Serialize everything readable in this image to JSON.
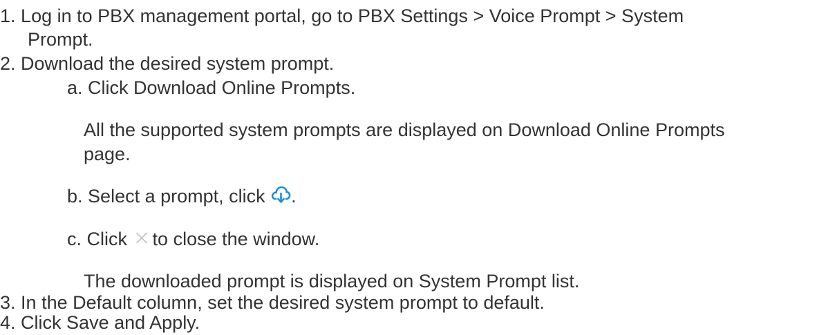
{
  "steps": [
    {
      "number": "1.",
      "text_line1": "Log in to PBX management portal, go to PBX Settings > Voice Prompt > System",
      "text_line2": "Prompt."
    },
    {
      "number": "2.",
      "text": "Download the desired system prompt.",
      "substeps": [
        {
          "letter": "a.",
          "text": "Click Download Online Prompts.",
          "note_line1": "All the supported system prompts are displayed on Download Online Prompts",
          "note_line2": "page."
        },
        {
          "letter": "b.",
          "text_before": "Select a prompt, click",
          "icon": "cloud-download-icon",
          "text_after": "."
        },
        {
          "letter": "c.",
          "text_before": "Click",
          "icon": "close-icon",
          "text_after": "to close the window.",
          "note": "The downloaded prompt is displayed on System Prompt list."
        }
      ]
    },
    {
      "number": "3.",
      "text": "In the Default column, set the desired system prompt to default."
    },
    {
      "number": "4.",
      "text": "Click Save and Apply."
    }
  ],
  "colors": {
    "text": "#333333",
    "download_icon": "#1a8fd6",
    "close_icon": "#c8c8c8"
  }
}
